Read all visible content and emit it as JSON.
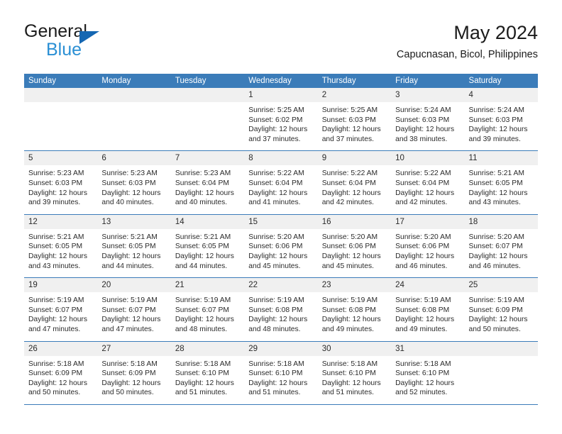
{
  "brand": {
    "word_top": "General",
    "word_bottom": "Blue",
    "flag_icon": "blue-triangle-flag-icon"
  },
  "header": {
    "month_title": "May 2024",
    "location": "Capucnasan, Bicol, Philippines"
  },
  "colors": {
    "header_blue": "#3b7cb9",
    "brand_blue": "#2a8fd4",
    "flag_blue": "#1567b2",
    "day_head_gray": "#f0f0f0",
    "text": "#2b2b2b"
  },
  "calendar": {
    "weekday_headers": [
      "Sunday",
      "Monday",
      "Tuesday",
      "Wednesday",
      "Thursday",
      "Friday",
      "Saturday"
    ],
    "weeks": [
      [
        {
          "date": "",
          "lines": []
        },
        {
          "date": "",
          "lines": []
        },
        {
          "date": "",
          "lines": []
        },
        {
          "date": "1",
          "lines": [
            "Sunrise: 5:25 AM",
            "Sunset: 6:02 PM",
            "Daylight: 12 hours",
            "and 37 minutes."
          ]
        },
        {
          "date": "2",
          "lines": [
            "Sunrise: 5:25 AM",
            "Sunset: 6:03 PM",
            "Daylight: 12 hours",
            "and 37 minutes."
          ]
        },
        {
          "date": "3",
          "lines": [
            "Sunrise: 5:24 AM",
            "Sunset: 6:03 PM",
            "Daylight: 12 hours",
            "and 38 minutes."
          ]
        },
        {
          "date": "4",
          "lines": [
            "Sunrise: 5:24 AM",
            "Sunset: 6:03 PM",
            "Daylight: 12 hours",
            "and 39 minutes."
          ]
        }
      ],
      [
        {
          "date": "5",
          "lines": [
            "Sunrise: 5:23 AM",
            "Sunset: 6:03 PM",
            "Daylight: 12 hours",
            "and 39 minutes."
          ]
        },
        {
          "date": "6",
          "lines": [
            "Sunrise: 5:23 AM",
            "Sunset: 6:03 PM",
            "Daylight: 12 hours",
            "and 40 minutes."
          ]
        },
        {
          "date": "7",
          "lines": [
            "Sunrise: 5:23 AM",
            "Sunset: 6:04 PM",
            "Daylight: 12 hours",
            "and 40 minutes."
          ]
        },
        {
          "date": "8",
          "lines": [
            "Sunrise: 5:22 AM",
            "Sunset: 6:04 PM",
            "Daylight: 12 hours",
            "and 41 minutes."
          ]
        },
        {
          "date": "9",
          "lines": [
            "Sunrise: 5:22 AM",
            "Sunset: 6:04 PM",
            "Daylight: 12 hours",
            "and 42 minutes."
          ]
        },
        {
          "date": "10",
          "lines": [
            "Sunrise: 5:22 AM",
            "Sunset: 6:04 PM",
            "Daylight: 12 hours",
            "and 42 minutes."
          ]
        },
        {
          "date": "11",
          "lines": [
            "Sunrise: 5:21 AM",
            "Sunset: 6:05 PM",
            "Daylight: 12 hours",
            "and 43 minutes."
          ]
        }
      ],
      [
        {
          "date": "12",
          "lines": [
            "Sunrise: 5:21 AM",
            "Sunset: 6:05 PM",
            "Daylight: 12 hours",
            "and 43 minutes."
          ]
        },
        {
          "date": "13",
          "lines": [
            "Sunrise: 5:21 AM",
            "Sunset: 6:05 PM",
            "Daylight: 12 hours",
            "and 44 minutes."
          ]
        },
        {
          "date": "14",
          "lines": [
            "Sunrise: 5:21 AM",
            "Sunset: 6:05 PM",
            "Daylight: 12 hours",
            "and 44 minutes."
          ]
        },
        {
          "date": "15",
          "lines": [
            "Sunrise: 5:20 AM",
            "Sunset: 6:06 PM",
            "Daylight: 12 hours",
            "and 45 minutes."
          ]
        },
        {
          "date": "16",
          "lines": [
            "Sunrise: 5:20 AM",
            "Sunset: 6:06 PM",
            "Daylight: 12 hours",
            "and 45 minutes."
          ]
        },
        {
          "date": "17",
          "lines": [
            "Sunrise: 5:20 AM",
            "Sunset: 6:06 PM",
            "Daylight: 12 hours",
            "and 46 minutes."
          ]
        },
        {
          "date": "18",
          "lines": [
            "Sunrise: 5:20 AM",
            "Sunset: 6:07 PM",
            "Daylight: 12 hours",
            "and 46 minutes."
          ]
        }
      ],
      [
        {
          "date": "19",
          "lines": [
            "Sunrise: 5:19 AM",
            "Sunset: 6:07 PM",
            "Daylight: 12 hours",
            "and 47 minutes."
          ]
        },
        {
          "date": "20",
          "lines": [
            "Sunrise: 5:19 AM",
            "Sunset: 6:07 PM",
            "Daylight: 12 hours",
            "and 47 minutes."
          ]
        },
        {
          "date": "21",
          "lines": [
            "Sunrise: 5:19 AM",
            "Sunset: 6:07 PM",
            "Daylight: 12 hours",
            "and 48 minutes."
          ]
        },
        {
          "date": "22",
          "lines": [
            "Sunrise: 5:19 AM",
            "Sunset: 6:08 PM",
            "Daylight: 12 hours",
            "and 48 minutes."
          ]
        },
        {
          "date": "23",
          "lines": [
            "Sunrise: 5:19 AM",
            "Sunset: 6:08 PM",
            "Daylight: 12 hours",
            "and 49 minutes."
          ]
        },
        {
          "date": "24",
          "lines": [
            "Sunrise: 5:19 AM",
            "Sunset: 6:08 PM",
            "Daylight: 12 hours",
            "and 49 minutes."
          ]
        },
        {
          "date": "25",
          "lines": [
            "Sunrise: 5:19 AM",
            "Sunset: 6:09 PM",
            "Daylight: 12 hours",
            "and 50 minutes."
          ]
        }
      ],
      [
        {
          "date": "26",
          "lines": [
            "Sunrise: 5:18 AM",
            "Sunset: 6:09 PM",
            "Daylight: 12 hours",
            "and 50 minutes."
          ]
        },
        {
          "date": "27",
          "lines": [
            "Sunrise: 5:18 AM",
            "Sunset: 6:09 PM",
            "Daylight: 12 hours",
            "and 50 minutes."
          ]
        },
        {
          "date": "28",
          "lines": [
            "Sunrise: 5:18 AM",
            "Sunset: 6:10 PM",
            "Daylight: 12 hours",
            "and 51 minutes."
          ]
        },
        {
          "date": "29",
          "lines": [
            "Sunrise: 5:18 AM",
            "Sunset: 6:10 PM",
            "Daylight: 12 hours",
            "and 51 minutes."
          ]
        },
        {
          "date": "30",
          "lines": [
            "Sunrise: 5:18 AM",
            "Sunset: 6:10 PM",
            "Daylight: 12 hours",
            "and 51 minutes."
          ]
        },
        {
          "date": "31",
          "lines": [
            "Sunrise: 5:18 AM",
            "Sunset: 6:10 PM",
            "Daylight: 12 hours",
            "and 52 minutes."
          ]
        },
        {
          "date": "",
          "lines": []
        }
      ]
    ]
  }
}
